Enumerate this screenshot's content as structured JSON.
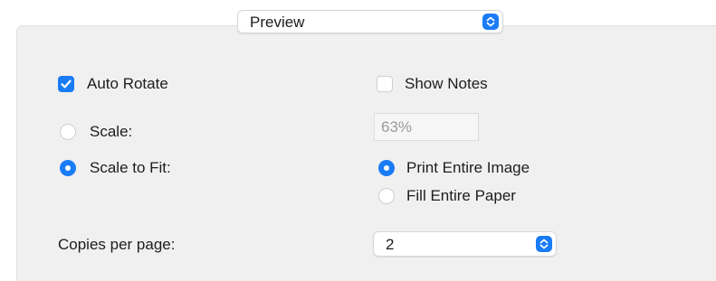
{
  "top_menu": {
    "selected": "Preview"
  },
  "options": {
    "auto_rotate": {
      "label": "Auto Rotate",
      "checked": true
    },
    "show_notes": {
      "label": "Show Notes",
      "checked": false
    },
    "scale": {
      "label": "Scale:",
      "selected": false
    },
    "scale_value": "63%",
    "scale_to_fit": {
      "label": "Scale to Fit:",
      "selected": true
    },
    "print_entire_image": {
      "label": "Print Entire Image",
      "selected": true
    },
    "fill_entire_paper": {
      "label": "Fill Entire Paper",
      "selected": false
    }
  },
  "copies_per_page": {
    "label": "Copies per page:",
    "selected": "2"
  },
  "colors": {
    "accent": "#1a7cf5",
    "panel_bg": "#f0f0f0"
  },
  "icons": {
    "popup_arrows": "chevron-up-down-icon",
    "checkmark": "checkmark-icon"
  }
}
